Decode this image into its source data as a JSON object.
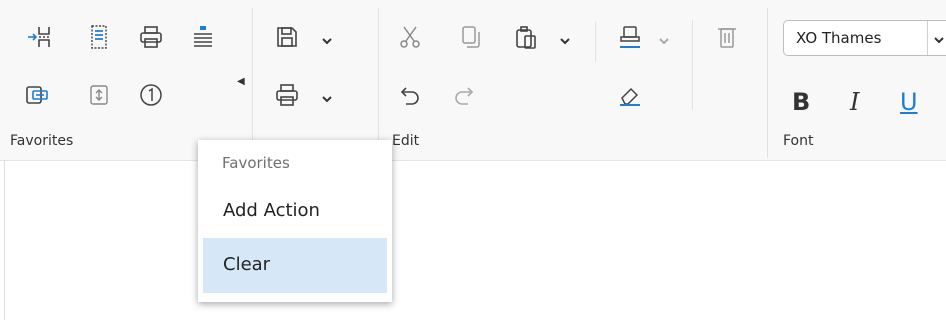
{
  "favorites_group": {
    "label": "Favorites"
  },
  "edit_group": {
    "label": "Edit"
  },
  "font_group": {
    "label": "Font",
    "font_name": "XO Thames",
    "bold_label": "B",
    "italic_label": "I",
    "underline_label": "U"
  },
  "favorites_menu": {
    "header": "Favorites",
    "items": [
      {
        "label": "Add Action"
      },
      {
        "label": "Clear"
      }
    ]
  },
  "colors": {
    "icon_stroke": "#444444",
    "icon_disabled": "#b0b0b0",
    "accent_blue": "#1c7ed6",
    "menu_highlight": "#d6e8f8",
    "ribbon_background": "#f8f8f8"
  }
}
